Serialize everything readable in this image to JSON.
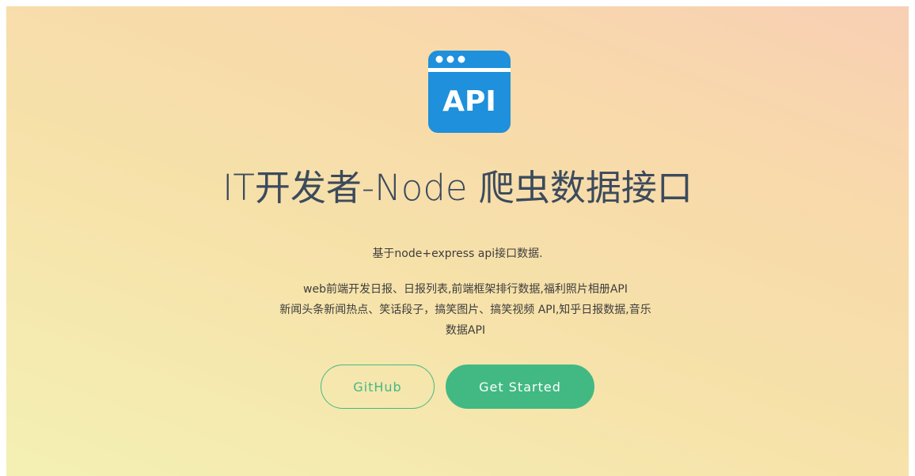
{
  "logo": {
    "icon": "api-window-icon",
    "text": "API",
    "color": "#1e90dc"
  },
  "title": "IT开发者-Node 爬虫数据接口",
  "tagline": "基于node+express api接口数据.",
  "description": {
    "lines": [
      "web前端开发日报、日报列表,前端框架排行数据,福利照片相册API",
      "新闻头条新闻热点、笑话段子，搞笑图片、搞笑视频 API,知乎日报数据,音乐",
      "数据API"
    ]
  },
  "buttons": {
    "github": "GitHub",
    "get_started": "Get Started"
  },
  "colors": {
    "accent": "#42b983",
    "title_text": "#3c4a5c"
  }
}
